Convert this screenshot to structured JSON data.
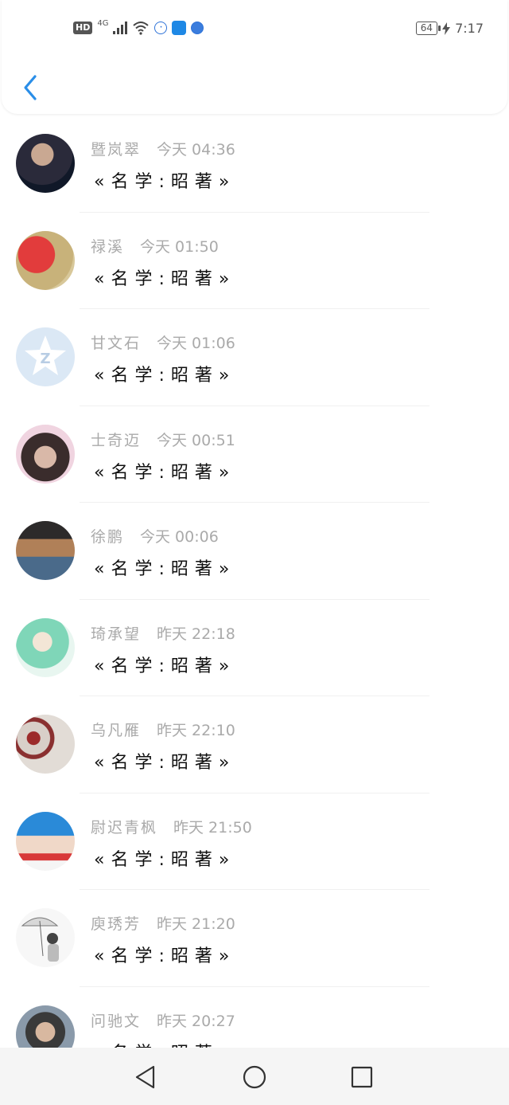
{
  "status_bar": {
    "hd": "HD",
    "network": "4G",
    "battery": "64",
    "time": "7:17"
  },
  "nav": {
    "back_icon": "chevron-left-icon"
  },
  "contacts": [
    {
      "name": "暨岚翠",
      "time": "今天 04:36",
      "message": "«名学:昭著»"
    },
    {
      "name": "禄溪",
      "time": "今天 01:50",
      "message": "«名学:昭著»"
    },
    {
      "name": "甘文石",
      "time": "今天 01:06",
      "message": "«名学:昭著»"
    },
    {
      "name": "士奇迈",
      "time": "今天 00:51",
      "message": "«名学:昭著»"
    },
    {
      "name": "徐鹏",
      "time": "今天 00:06",
      "message": "«名学:昭著»"
    },
    {
      "name": "琦承望",
      "time": "昨天 22:18",
      "message": "«名学:昭著»"
    },
    {
      "name": "乌凡雁",
      "time": "昨天 22:10",
      "message": "«名学:昭著»"
    },
    {
      "name": "尉迟青枫",
      "time": "昨天 21:50",
      "message": "«名学:昭著»"
    },
    {
      "name": "庾琇芳",
      "time": "昨天 21:20",
      "message": "«名学:昭著»"
    },
    {
      "name": "问驰文",
      "time": "昨天 20:27",
      "message": "«名学:昭著»"
    }
  ],
  "system_nav": {
    "back": "triangle-back-icon",
    "home": "circle-home-icon",
    "recents": "square-recents-icon"
  },
  "colors": {
    "accent": "#2a8ee8",
    "name_gray": "#aaaaaa",
    "message": "#111111"
  }
}
